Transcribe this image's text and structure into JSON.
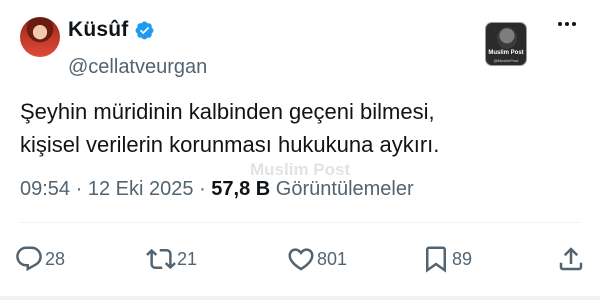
{
  "tweet": {
    "display_name": "Küsûf",
    "handle": "@cellatveurgan",
    "text_lines": [
      "Şeyhin müridinin kalbinden geçeni bilmesi,",
      "kişisel verilerin korunması hukukuna aykırı."
    ],
    "time": "09:54",
    "date": "12 Eki 2025",
    "views_count": "57,8 B",
    "views_label": "Görüntülemeler",
    "separator": "·"
  },
  "badge": {
    "title": "Muslim Post",
    "subtitle": "@MuslimPost"
  },
  "watermark": "Muslim Post",
  "actions": {
    "replies": "28",
    "reposts": "21",
    "likes": "801",
    "bookmarks": "89"
  },
  "colors": {
    "verified": "#1d9bf0",
    "text": "#0f1419",
    "secondary": "#536471"
  },
  "icons": {
    "verified": "verified-badge-icon",
    "more": "more-options-icon",
    "reply": "reply-icon",
    "repost": "repost-icon",
    "like": "like-icon",
    "bookmark": "bookmark-icon",
    "share": "share-icon"
  }
}
